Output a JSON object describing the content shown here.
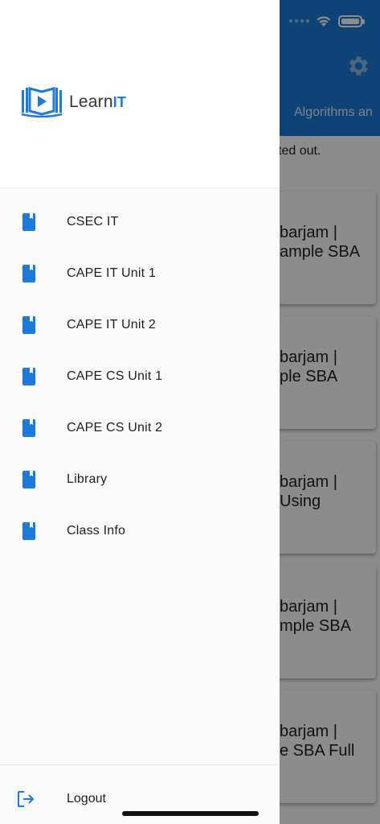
{
  "background": {
    "tab_label": "Algorithms an",
    "note_text": "ted out.",
    "cards": [
      {
        "line1": "barjam |",
        "line2": "ample SBA"
      },
      {
        "line1": "barjam |",
        "line2": "ple SBA"
      },
      {
        "line1": "barjam |",
        "line2": " Using"
      },
      {
        "line1": "barjam |",
        "line2": "mple SBA"
      },
      {
        "line1": "barjam |",
        "line2": "e SBA Full"
      }
    ]
  },
  "drawer": {
    "logo": {
      "text_main": "Learn",
      "text_accent": "IT"
    },
    "items": [
      {
        "label": "CSEC IT"
      },
      {
        "label": "CAPE IT Unit 1"
      },
      {
        "label": "CAPE IT Unit 2"
      },
      {
        "label": "CAPE CS Unit 1"
      },
      {
        "label": "CAPE CS Unit 2"
      },
      {
        "label": "Library"
      },
      {
        "label": "Class Info"
      }
    ],
    "logout_label": "Logout"
  },
  "colors": {
    "accent": "#1d7ad9",
    "header": "#1d7ad9"
  },
  "icons": {
    "menu_item": "bookmark-icon",
    "logout": "logout-icon",
    "settings": "gear-icon",
    "wifi": "wifi-icon",
    "battery": "battery-icon"
  }
}
